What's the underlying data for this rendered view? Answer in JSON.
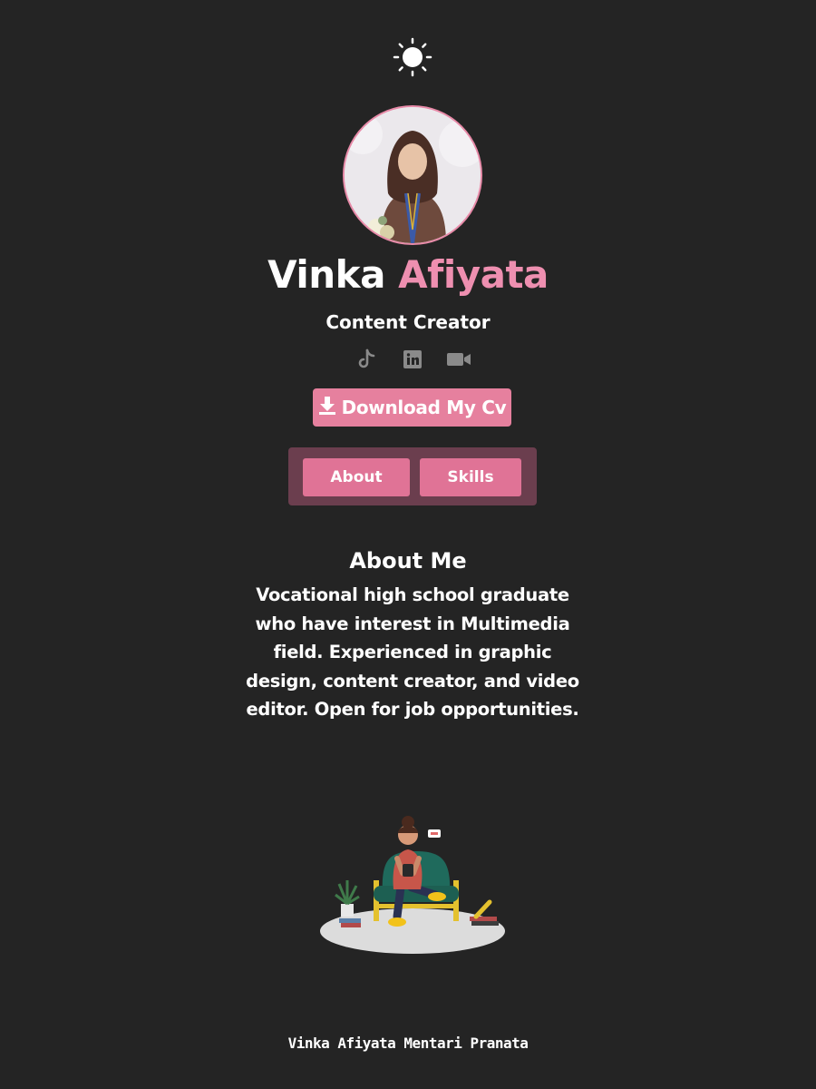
{
  "header": {
    "theme_icon": "sun-icon"
  },
  "profile": {
    "photo_alt": "profile-photo",
    "first_name": "Vinka",
    "last_name": "Afiyata",
    "role": "Content Creator",
    "accent": "#ee8fb0"
  },
  "socials": [
    {
      "icon": "tiktok-icon"
    },
    {
      "icon": "linkedin-icon"
    },
    {
      "icon": "video-camera-icon"
    }
  ],
  "download": {
    "label": "Download My Cv",
    "icon": "download-icon"
  },
  "tabs": [
    {
      "label": "About"
    },
    {
      "label": "Skills"
    }
  ],
  "about": {
    "title": "About Me",
    "text": "Vocational high school graduate who have interest in Multimedia field. Experienced in graphic design, content creator, and video editor. Open for job opportunities."
  },
  "footer": {
    "text": "Vinka Afiyata Mentari Pranata"
  },
  "colors": {
    "background": "#242424",
    "button": "#e6809e",
    "tab_bar": "#6b3e4e",
    "tab": "#e07396"
  }
}
